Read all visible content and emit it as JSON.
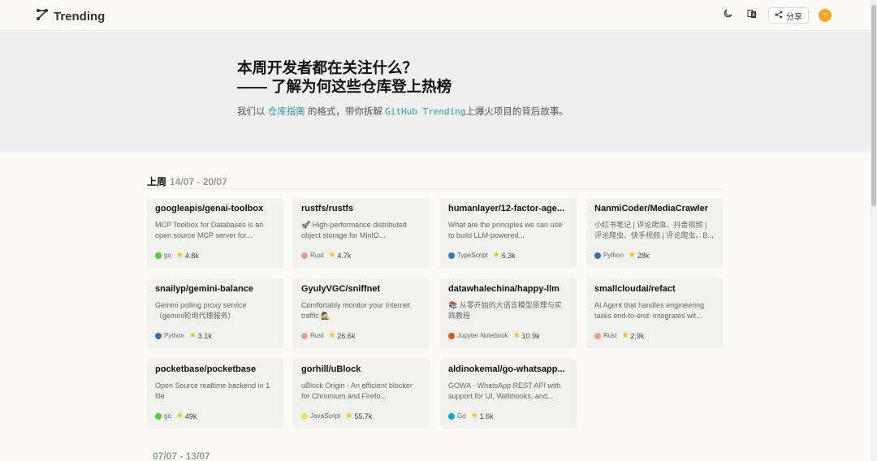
{
  "header": {
    "title": "Trending",
    "share_label": "分享",
    "avatar_letter": "T"
  },
  "hero": {
    "title_line1": "本周开发者都在关注什么？",
    "title_line2": "—— 了解为何这些仓库登上热榜",
    "sub_prefix": "我们以 ",
    "sub_link": "仓库指南",
    "sub_mid": " 的格式，带你拆解 ",
    "sub_code": "GitHub Trending",
    "sub_suffix": "上爆火项目的背后故事。"
  },
  "week": {
    "label": "上周",
    "range": "14/07 - 20/07"
  },
  "repos": [
    {
      "name": "googleapis/genai-toolbox",
      "desc": "MCP Toolbox for Databases is an open source MCP server for...",
      "lang": "go",
      "lang_color": "#4cd137",
      "stars": "4.8k"
    },
    {
      "name": "rustfs/rustfs",
      "desc": "🚀 High-performance distributed object storage for MinIO...",
      "lang": "Rust",
      "lang_color": "#dea584",
      "stars": "4.7k"
    },
    {
      "name": "humanlayer/12-factor-age...",
      "desc": "What are the principles we can use to build LLM-powered...",
      "lang": "TypeScript",
      "lang_color": "#3178c6",
      "stars": "6.3k"
    },
    {
      "name": "NanmiCoder/MediaCrawler",
      "desc": "小红书笔记 | 评论爬虫、抖音视频 | 评论爬虫、快手视频 | 评论爬虫、B...",
      "lang": "Python",
      "lang_color": "#3572A5",
      "stars": "28k"
    },
    {
      "name": "snailyp/gemini-balance",
      "desc": "Gemini polling proxy service （gemini轮询代理服务）",
      "lang": "Python",
      "lang_color": "#3572A5",
      "stars": "3.1k"
    },
    {
      "name": "GyulyVGC/sniffnet",
      "desc": "Comfortably monitor your Internet traffic 🕵️",
      "lang": "Rust",
      "lang_color": "#dea584",
      "stars": "26.6k"
    },
    {
      "name": "datawhalechina/happy-llm",
      "desc": "📚 从零开始的大语言模型原理与实践教程",
      "lang": "Jupyter Notebook",
      "lang_color": "#DA5B0B",
      "stars": "10.9k"
    },
    {
      "name": "smallcloudai/refact",
      "desc": "AI Agent that handles engineering tasks end-to-end: integrates wit...",
      "lang": "Rust",
      "lang_color": "#dea584",
      "stars": "2.9k"
    },
    {
      "name": "pocketbase/pocketbase",
      "desc": "Open Source realtime backend in 1 file",
      "lang": "go",
      "lang_color": "#4cd137",
      "stars": "49k"
    },
    {
      "name": "gorhill/uBlock",
      "desc": "uBlock Origin - An efficient blocker for Chromium and Firefo...",
      "lang": "JavaScript",
      "lang_color": "#f1e05a",
      "stars": "55.7k"
    },
    {
      "name": "aldinokemal/go-whatsapp...",
      "desc": "GOWA - WhatsApp REST API with support for UI, Webhooks, and...",
      "lang": "Go",
      "lang_color": "#00ADD8",
      "stars": "1.6k"
    }
  ],
  "next_week": {
    "range": "07/07 - 13/07"
  },
  "icons": {
    "logo": "trending-logo-icon",
    "theme": "moon-icon",
    "translate": "translate-icon",
    "share": "share-icon",
    "star": "star-icon"
  }
}
